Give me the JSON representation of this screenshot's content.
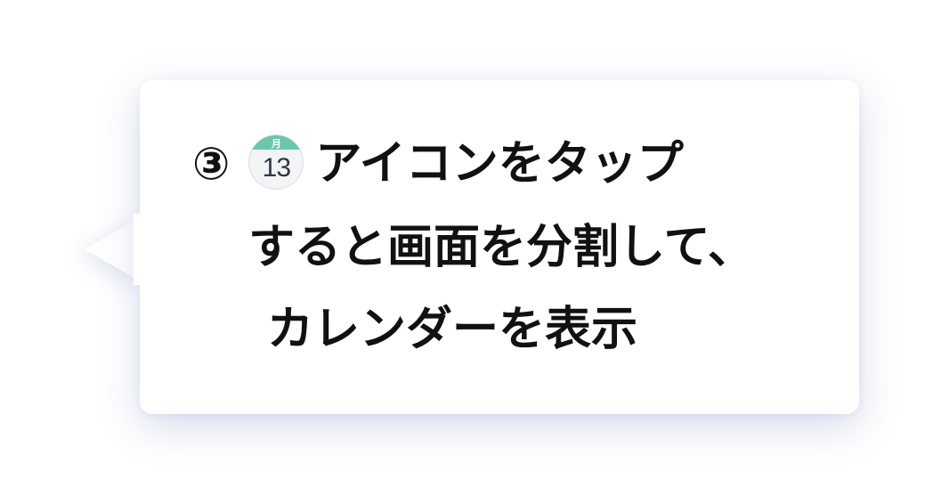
{
  "callout": {
    "step_number": "③",
    "line1_text": "アイコンをタップ",
    "line2_text": "すると画面を分割して、",
    "line3_text": "カレンダーを表示"
  },
  "calendar_icon": {
    "month_label": "月",
    "day_label": "13",
    "header_color": "#68c9a9",
    "body_color": "#f3f4f6"
  }
}
